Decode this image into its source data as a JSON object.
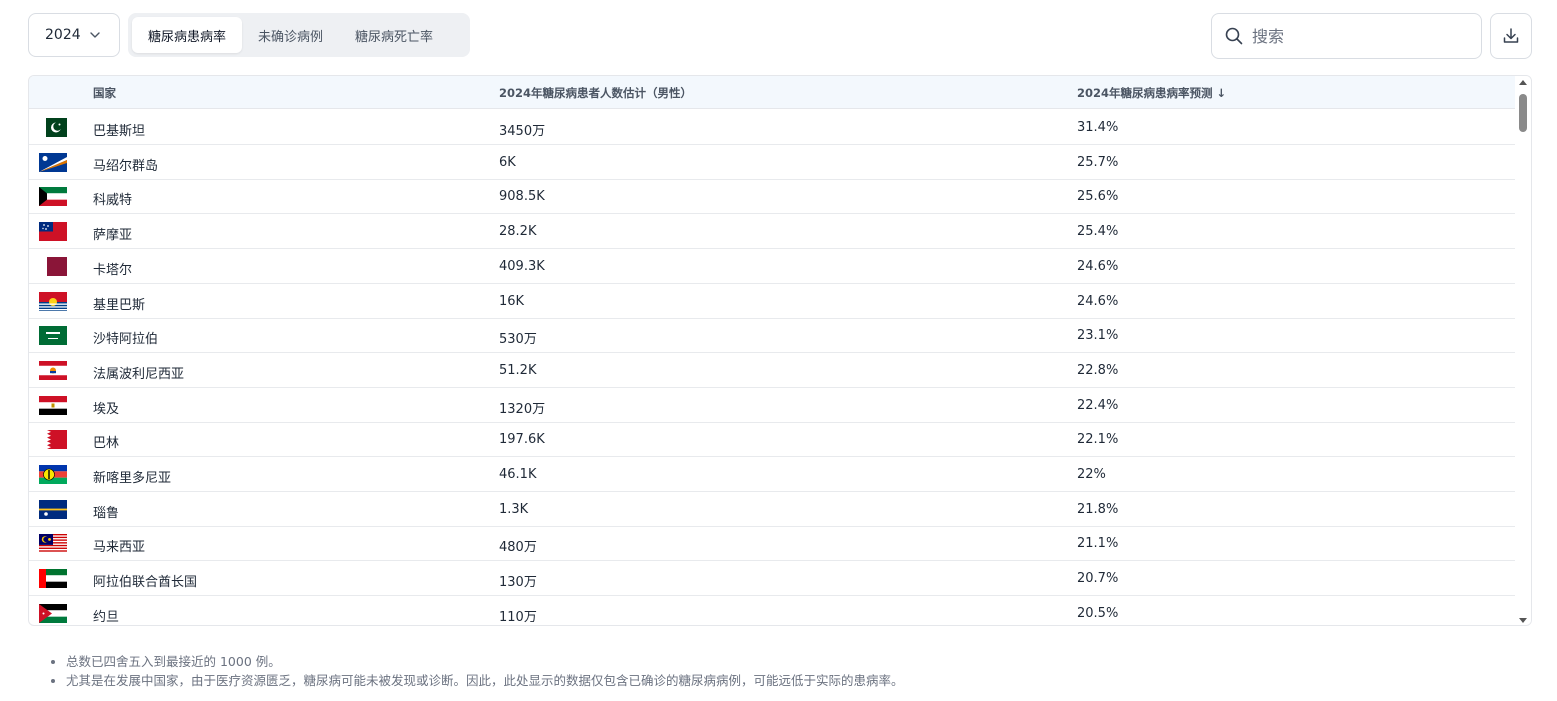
{
  "year_select": {
    "value": "2024"
  },
  "tabs": [
    {
      "label": "糖尿病患病率",
      "active": true
    },
    {
      "label": "未确诊病例",
      "active": false
    },
    {
      "label": "糖尿病死亡率",
      "active": false
    }
  ],
  "search": {
    "placeholder": "搜索"
  },
  "table": {
    "headers": {
      "country": "国家",
      "cases": "2024年糖尿病患者人数估计（男性）",
      "rate": "2024年糖尿病患病率预测 ↓"
    },
    "rows": [
      {
        "flag": "pakistan",
        "country": "巴基斯坦",
        "cases": "3450万",
        "rate": "31.4%"
      },
      {
        "flag": "marshall-islands",
        "country": "马绍尔群岛",
        "cases": "6K",
        "rate": "25.7%"
      },
      {
        "flag": "kuwait",
        "country": "科威特",
        "cases": "908.5K",
        "rate": "25.6%"
      },
      {
        "flag": "samoa",
        "country": "萨摩亚",
        "cases": "28.2K",
        "rate": "25.4%"
      },
      {
        "flag": "qatar",
        "country": "卡塔尔",
        "cases": "409.3K",
        "rate": "24.6%"
      },
      {
        "flag": "kiribati",
        "country": "基里巴斯",
        "cases": "16K",
        "rate": "24.6%"
      },
      {
        "flag": "saudi-arabia",
        "country": "沙特阿拉伯",
        "cases": "530万",
        "rate": "23.1%"
      },
      {
        "flag": "french-polynesia",
        "country": "法属波利尼西亚",
        "cases": "51.2K",
        "rate": "22.8%"
      },
      {
        "flag": "egypt",
        "country": "埃及",
        "cases": "1320万",
        "rate": "22.4%"
      },
      {
        "flag": "bahrain",
        "country": "巴林",
        "cases": "197.6K",
        "rate": "22.1%"
      },
      {
        "flag": "new-caledonia",
        "country": "新喀里多尼亚",
        "cases": "46.1K",
        "rate": "22%"
      },
      {
        "flag": "nauru",
        "country": "瑙鲁",
        "cases": "1.3K",
        "rate": "21.8%"
      },
      {
        "flag": "malaysia",
        "country": "马来西亚",
        "cases": "480万",
        "rate": "21.1%"
      },
      {
        "flag": "uae",
        "country": "阿拉伯联合酋长国",
        "cases": "130万",
        "rate": "20.7%"
      },
      {
        "flag": "jordan",
        "country": "约旦",
        "cases": "110万",
        "rate": "20.5%"
      }
    ]
  },
  "notes": [
    "总数已四舍五入到最接近的 1000 例。",
    "尤其是在发展中国家，由于医疗资源匮乏，糖尿病可能未被发现或诊断。因此，此处显示的数据仅包含已确诊的糖尿病病例，可能远低于实际的患病率。"
  ],
  "colors": {
    "header_bg": "#f3f8fd",
    "border": "#e5e7eb",
    "tab_bg": "#eef0f3"
  }
}
